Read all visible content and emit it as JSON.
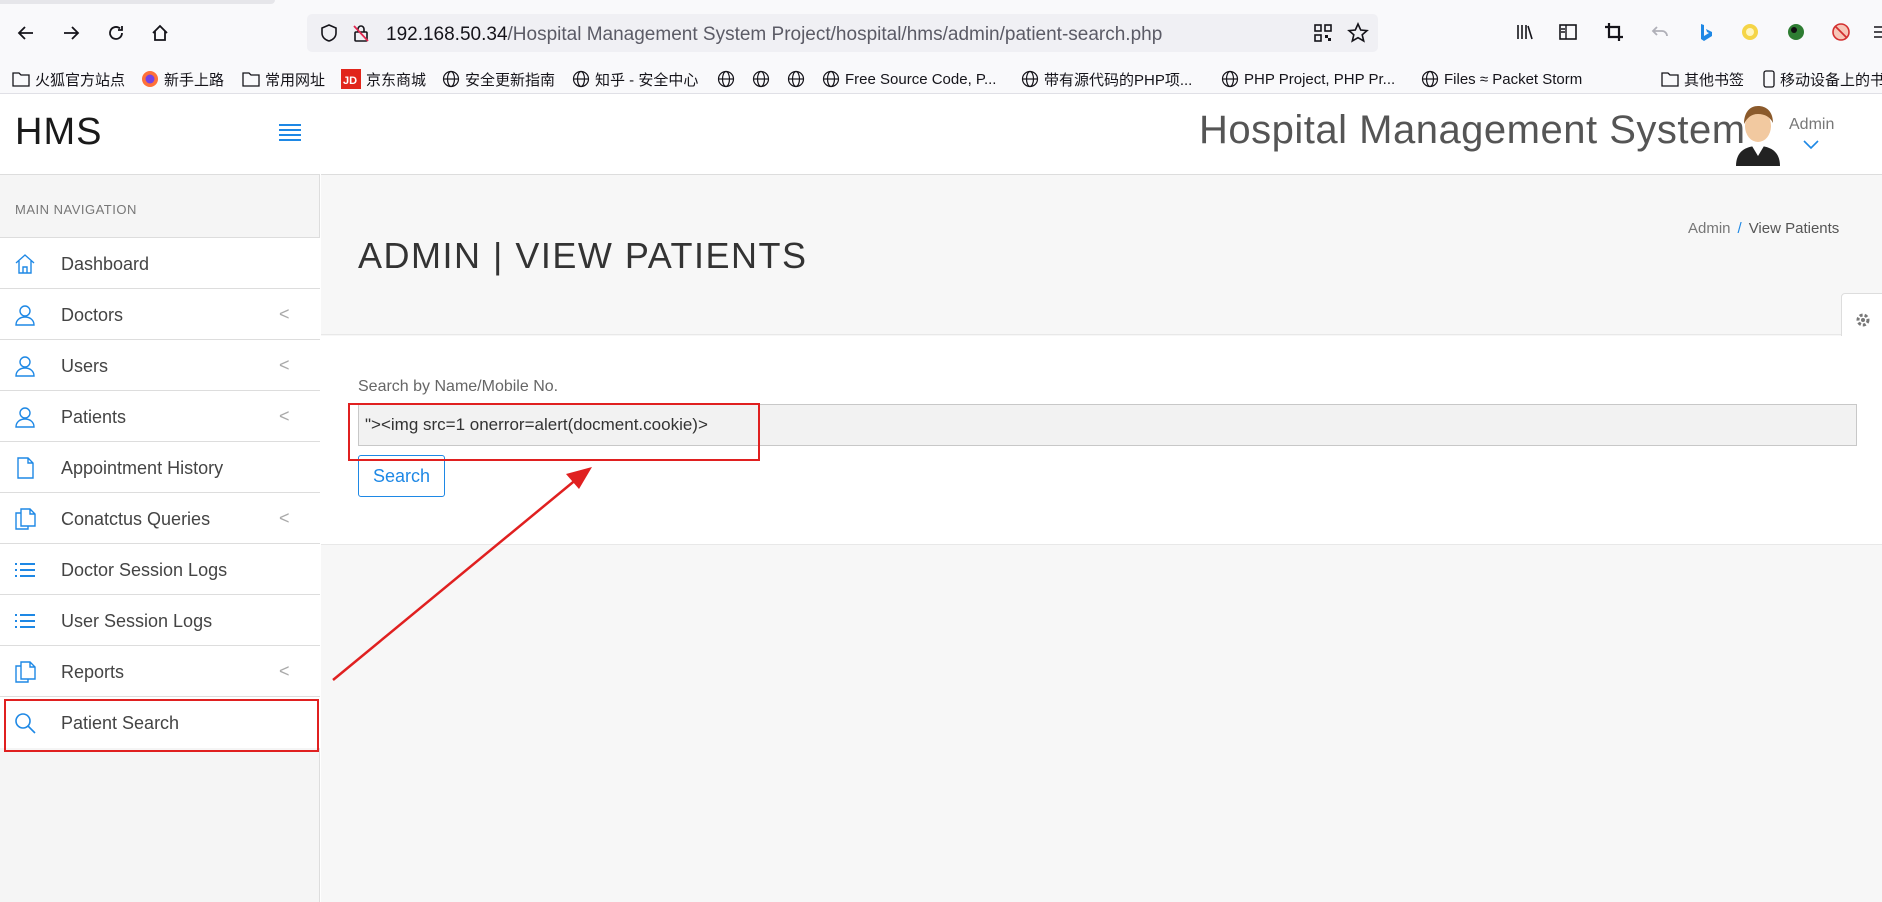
{
  "browser": {
    "url_host": "192.168.50.34",
    "url_path": "/Hospital Management System Project/hospital/hms/admin/patient-search.php"
  },
  "bookmarks": [
    {
      "label": "火狐官方站点",
      "icon": "folder-icon"
    },
    {
      "label": "新手上路",
      "icon": "firefox-icon"
    },
    {
      "label": "常用网址",
      "icon": "folder-icon"
    },
    {
      "label": "京东商城",
      "icon": "jd-icon"
    },
    {
      "label": "安全更新指南",
      "icon": "globe-icon"
    },
    {
      "label": "知乎 - 安全中心",
      "icon": "globe-icon"
    },
    {
      "label": "",
      "icon": "globe-icon"
    },
    {
      "label": "",
      "icon": "globe-icon"
    },
    {
      "label": "",
      "icon": "globe-icon"
    },
    {
      "label": "Free Source Code, P...",
      "icon": "globe-icon"
    },
    {
      "label": "带有源代码的PHP项...",
      "icon": "globe-icon"
    },
    {
      "label": "PHP Project, PHP Pr...",
      "icon": "globe-icon"
    },
    {
      "label": "Files ≈ Packet Storm",
      "icon": "globe-icon"
    },
    {
      "label": "其他书签",
      "icon": "folder-icon"
    },
    {
      "label": "移动设备上的书",
      "icon": "mobile-icon"
    }
  ],
  "app": {
    "brand": "HMS",
    "system_title": "Hospital Management System",
    "user_name": "Admin"
  },
  "sidebar": {
    "section_label": "MAIN NAVIGATION",
    "items": [
      {
        "label": "Dashboard",
        "icon": "home-icon",
        "has_submenu": false
      },
      {
        "label": "Doctors",
        "icon": "user-icon",
        "has_submenu": true
      },
      {
        "label": "Users",
        "icon": "user-icon",
        "has_submenu": true
      },
      {
        "label": "Patients",
        "icon": "user-icon",
        "has_submenu": true
      },
      {
        "label": "Appointment History",
        "icon": "file-icon",
        "has_submenu": false
      },
      {
        "label": "Conatctus Queries",
        "icon": "files-icon",
        "has_submenu": true
      },
      {
        "label": "Doctor Session Logs",
        "icon": "list-icon",
        "has_submenu": false
      },
      {
        "label": "User Session Logs",
        "icon": "list-icon",
        "has_submenu": false
      },
      {
        "label": "Reports",
        "icon": "files-icon",
        "has_submenu": true
      },
      {
        "label": "Patient Search",
        "icon": "search-icon",
        "has_submenu": false
      }
    ]
  },
  "page": {
    "title": "ADMIN | VIEW PATIENTS",
    "breadcrumb": [
      "Admin",
      "View Patients"
    ],
    "search_label": "Search by Name/Mobile No.",
    "search_value": "\"><img src=1 onerror=alert(docment.cookie)>",
    "search_button": "Search"
  },
  "colors": {
    "accent": "#1e88e5",
    "annotation": "#e02020"
  }
}
